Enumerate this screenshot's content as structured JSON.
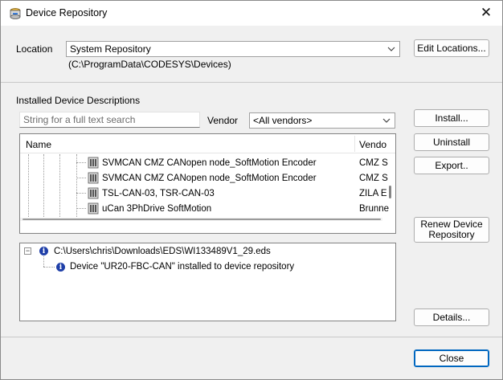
{
  "window": {
    "title": "Device Repository",
    "close_glyph": "✕",
    "title_icon": "device-repository-icon"
  },
  "location": {
    "label": "Location",
    "selected": "System Repository",
    "path": "(C:\\ProgramData\\CODESYS\\Devices)",
    "edit_button": "Edit Locations..."
  },
  "installed": {
    "heading": "Installed Device Descriptions",
    "search_placeholder": "String for a full text search",
    "vendor_label": "Vendor",
    "vendor_selected": "<All vendors>",
    "columns": {
      "name": "Name",
      "vendor": "Vendo"
    },
    "rows": [
      {
        "name": "SVMCAN CMZ CANopen node_SoftMotion Encoder",
        "vendor": "CMZ S"
      },
      {
        "name": "SVMCAN CMZ CANopen node_SoftMotion Encoder",
        "vendor": "CMZ S"
      },
      {
        "name": "TSL-CAN-03, TSR-CAN-03",
        "vendor": "ZILA E"
      },
      {
        "name": "uCan 3PhDrive SoftMotion",
        "vendor": "Brunne"
      }
    ]
  },
  "buttons": {
    "install": "Install...",
    "uninstall": "Uninstall",
    "export": "Export..",
    "renew_line1": "Renew Device",
    "renew_line2": "Repository",
    "details": "Details...",
    "close": "Close"
  },
  "log": {
    "collapse_glyph": "−",
    "file_path": "C:\\Users\\chris\\Downloads\\EDS\\WI133489V1_29.eds",
    "message": "Device \"UR20-FBC-CAN\" installed to device repository"
  },
  "colors": {
    "dialog_bg": "#f0f0f0",
    "accent": "#0067c0",
    "info_icon": "#1f3fa8"
  }
}
